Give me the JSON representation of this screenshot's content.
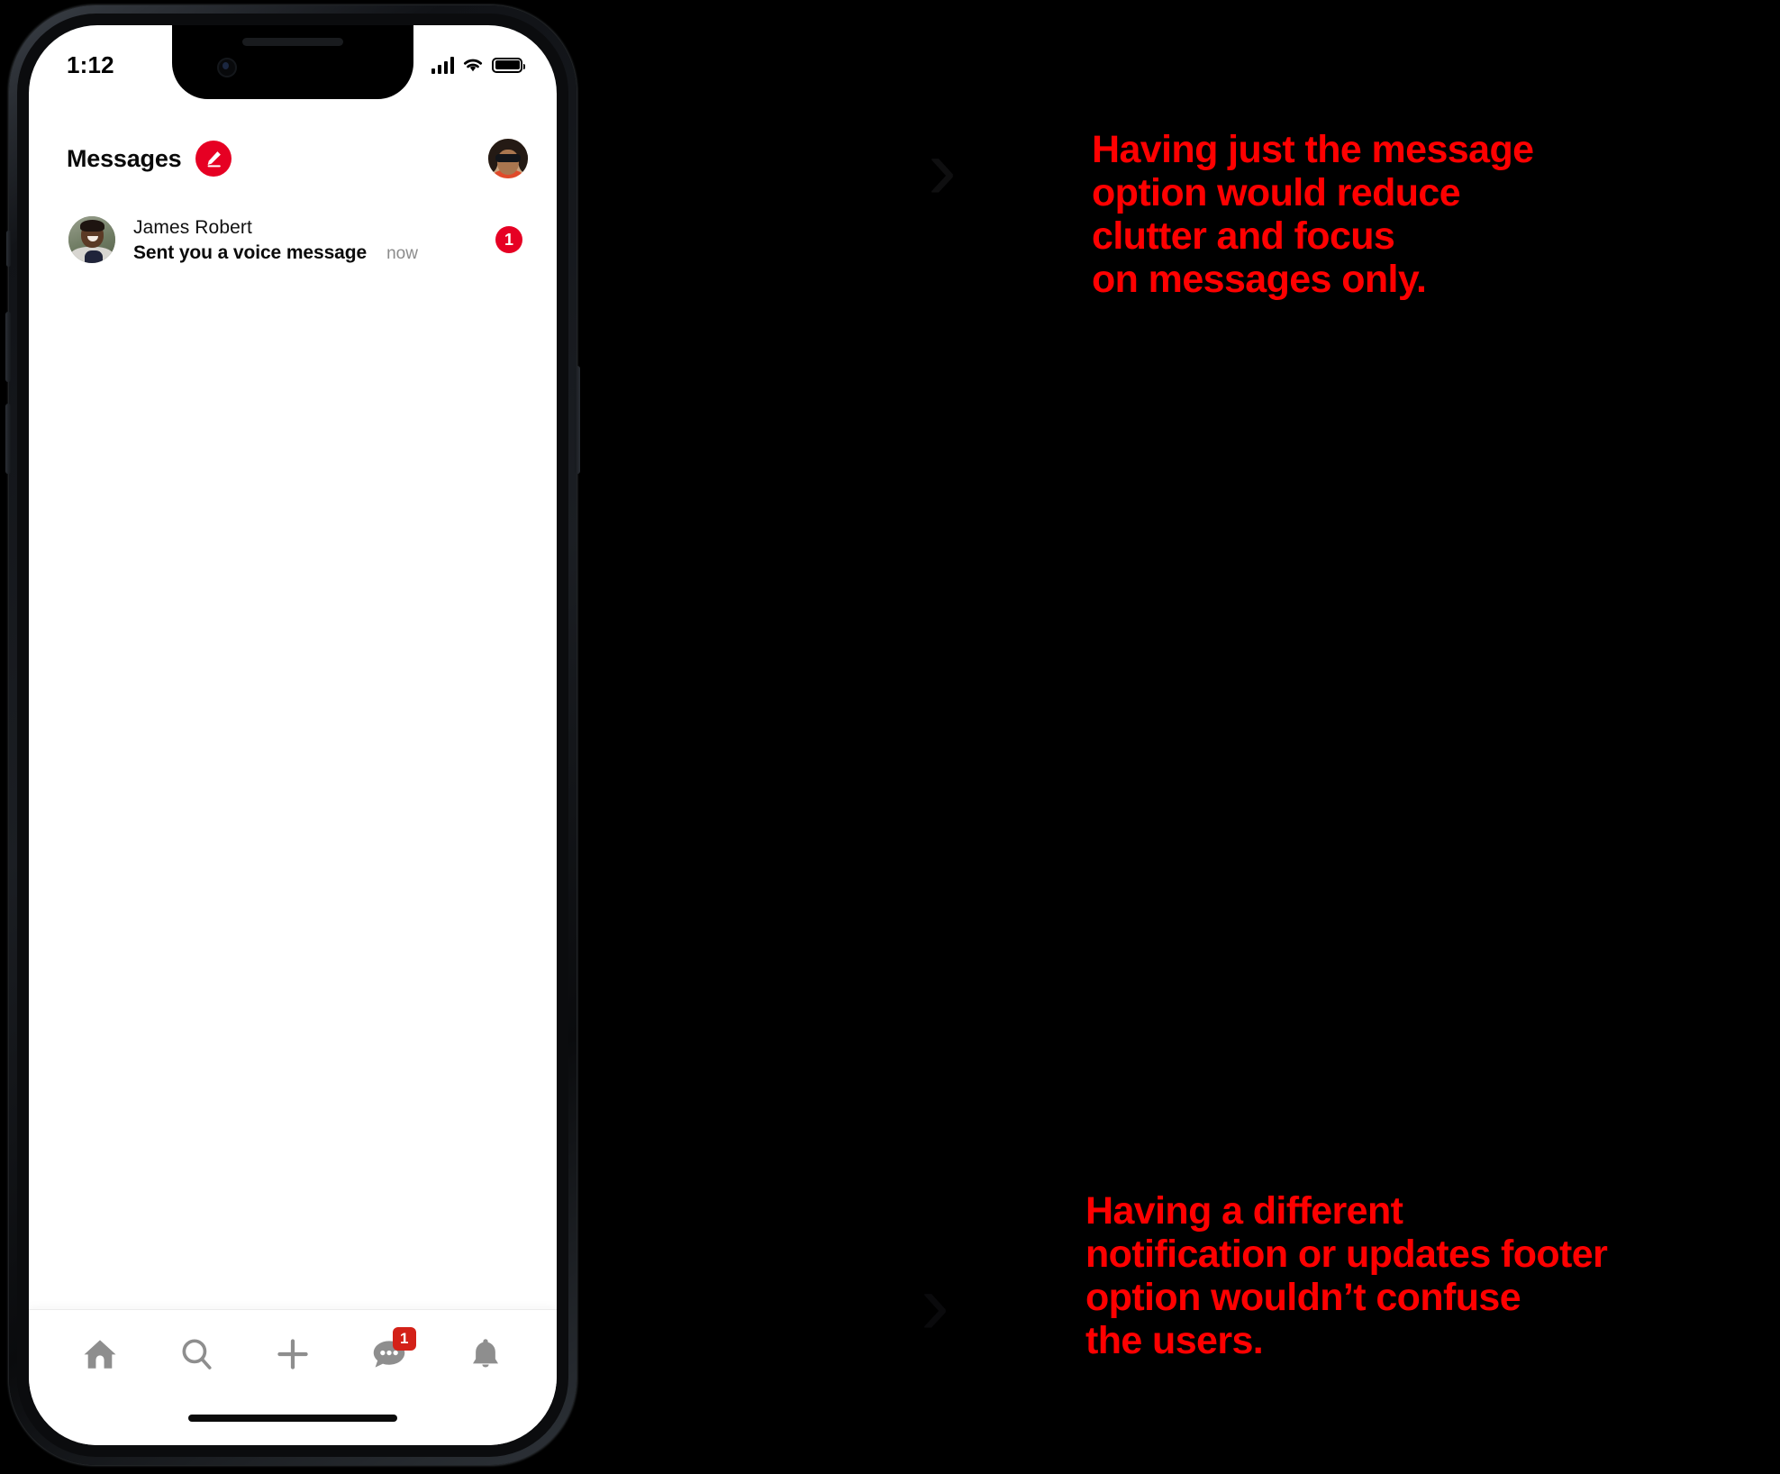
{
  "phone": {
    "status_bar": {
      "time": "1:12",
      "signal_icon": "cellular-signal-icon",
      "wifi_icon": "wifi-icon",
      "battery_icon": "battery-full-icon"
    },
    "app_header": {
      "title": "Messages",
      "compose_icon": "compose-pencil-icon",
      "profile_avatar": "user-avatar"
    },
    "messages": [
      {
        "name": "James Robert",
        "preview": "Sent you a voice message",
        "time": "now",
        "unread_count": "1",
        "avatar": "contact-avatar"
      }
    ],
    "bottom_nav": [
      {
        "id": "home",
        "icon": "home-icon",
        "badge": ""
      },
      {
        "id": "search",
        "icon": "search-icon",
        "badge": ""
      },
      {
        "id": "create",
        "icon": "plus-icon",
        "badge": ""
      },
      {
        "id": "messages",
        "icon": "chat-bubble-icon",
        "badge": "1"
      },
      {
        "id": "updates",
        "icon": "bell-icon",
        "badge": ""
      }
    ]
  },
  "annotations": [
    {
      "marker": "›",
      "text": "Having just the message\noption would reduce\nclutter and focus\non messages only."
    },
    {
      "marker": "›",
      "text": "Having a different\nnotification or updates footer\noption wouldn’t confuse\nthe users."
    }
  ],
  "colors": {
    "accent_red": "#E60023",
    "annotation_red": "#FF0000",
    "nav_badge_red": "#D32118",
    "background": "#000000",
    "screen": "#FFFFFF"
  }
}
